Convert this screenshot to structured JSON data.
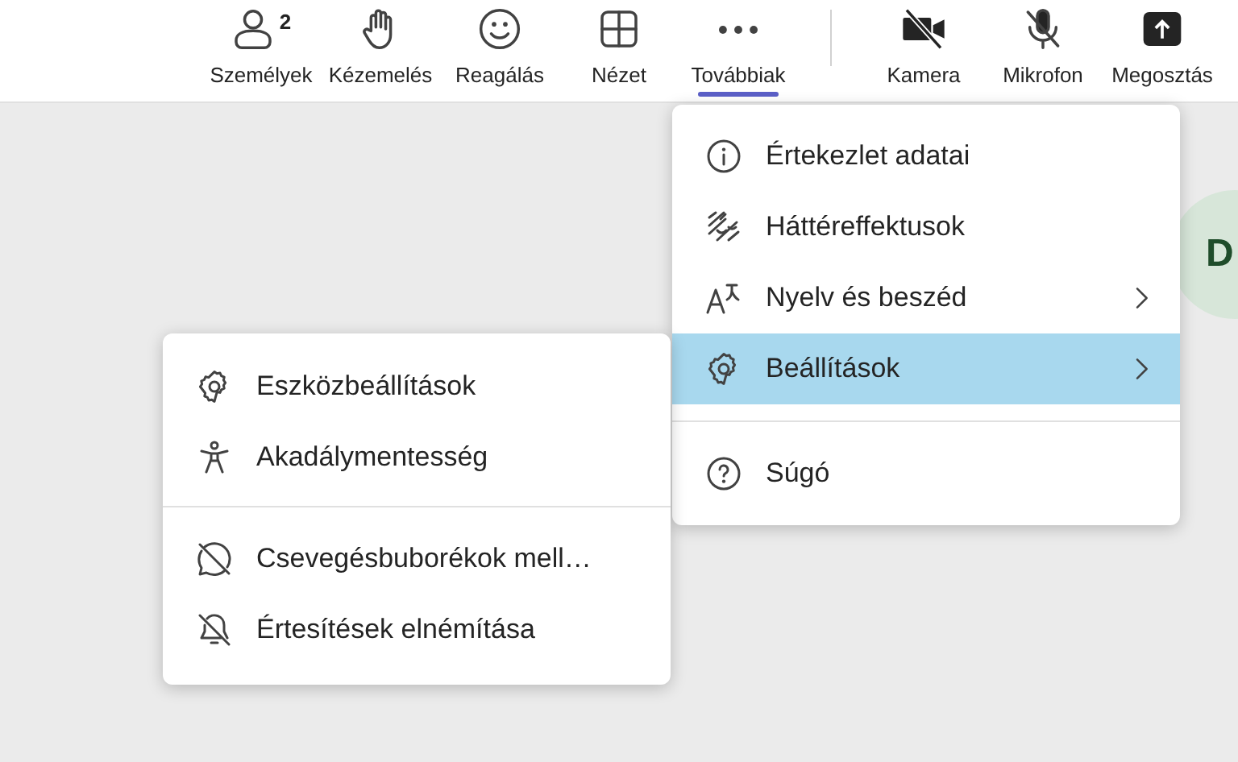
{
  "toolbar": {
    "items": [
      {
        "label": "Személyek",
        "badge": "2",
        "selected": false
      },
      {
        "label": "Kézemelés",
        "selected": false
      },
      {
        "label": "Reagálás",
        "selected": false
      },
      {
        "label": "Nézet",
        "selected": false
      },
      {
        "label": "Továbbiak",
        "selected": true
      }
    ],
    "media": [
      {
        "label": "Kamera"
      },
      {
        "label": "Mikrofon"
      },
      {
        "label": "Megosztás"
      }
    ]
  },
  "avatar": {
    "initial": "D"
  },
  "more_menu": {
    "groups": [
      [
        {
          "label": "Értekezlet adatai",
          "submenu": false,
          "selected": false
        },
        {
          "label": "Háttéreffektusok",
          "submenu": false,
          "selected": false
        },
        {
          "label": "Nyelv és beszéd",
          "submenu": true,
          "selected": false
        },
        {
          "label": "Beállítások",
          "submenu": true,
          "selected": true
        }
      ],
      [
        {
          "label": "Súgó",
          "submenu": false,
          "selected": false
        }
      ]
    ]
  },
  "settings_submenu": {
    "groups": [
      [
        {
          "label": "Eszközbeállítások"
        },
        {
          "label": "Akadálymentesség"
        }
      ],
      [
        {
          "label": "Csevegésbuborékok mell…"
        },
        {
          "label": "Értesítések elnémítása"
        }
      ]
    ]
  }
}
